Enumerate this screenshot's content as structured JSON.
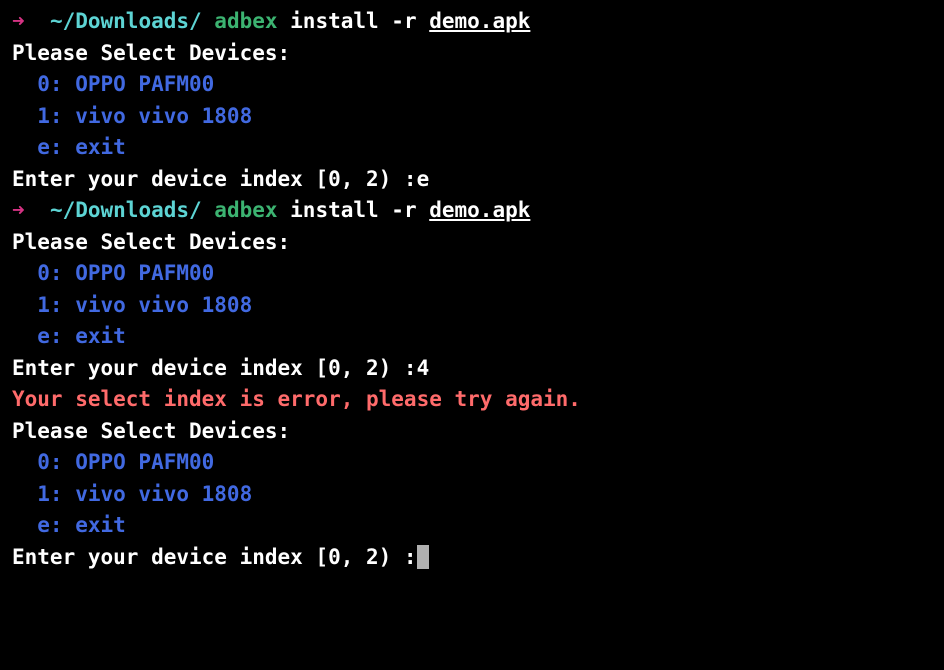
{
  "prompt1": {
    "arrow": "➜  ",
    "path": "~/Downloads/",
    "cmd": " adbex",
    "args_pre": " install -r ",
    "file": "demo.apk"
  },
  "selectHeader": "Please Select Devices:",
  "devices": {
    "d0": "  0: OPPO PAFM00",
    "d1": "  1: vivo vivo 1808",
    "exit": "  e: exit"
  },
  "enterPrompt": "Enter your device index [0, 2) :",
  "input1": "e",
  "input2": "4",
  "errorMsg": "Your select index is error, please try again."
}
